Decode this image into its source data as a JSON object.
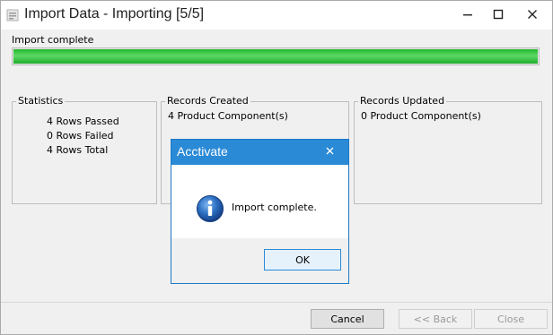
{
  "window": {
    "title": "Import Data - Importing [5/5]",
    "controls": {
      "minimize": "minimize",
      "maximize": "maximize",
      "close": "close"
    }
  },
  "progress": {
    "label": "Import complete",
    "percent": 100,
    "color": "#2ec237"
  },
  "statistics": {
    "title": "Statistics",
    "lines": [
      "4 Rows Passed",
      "0 Rows Failed",
      "4 Rows Total"
    ]
  },
  "records_created": {
    "title": "Records Created",
    "lines": [
      "4 Product Component(s)"
    ]
  },
  "records_updated": {
    "title": "Records Updated",
    "lines": [
      "0 Product Component(s)"
    ]
  },
  "footer": {
    "cancel_label": "Cancel",
    "back_label": "<< Back",
    "close_label": "Close",
    "back_enabled": false,
    "close_enabled": false
  },
  "dialog": {
    "title": "Acctivate",
    "message": "Import complete.",
    "ok_label": "OK",
    "icon": "info-icon",
    "accent_color": "#2b8ad6"
  }
}
